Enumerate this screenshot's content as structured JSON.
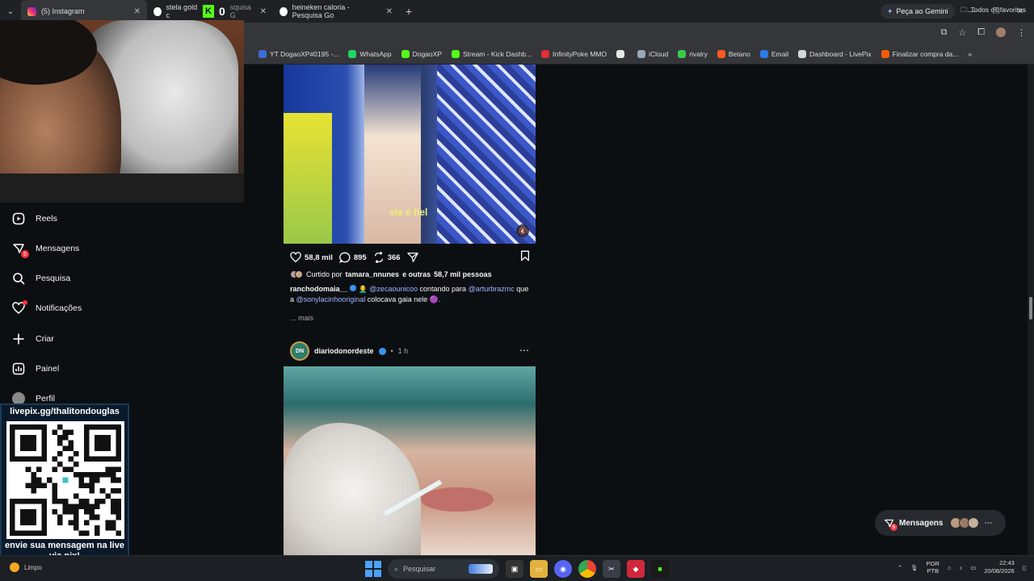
{
  "browser": {
    "tabs": [
      {
        "label": "(5) Instagram",
        "active": true,
        "icon": "instagram-icon"
      },
      {
        "label": "stela gold c",
        "active": false,
        "icon": "google-icon"
      },
      {
        "label": "heineken caloria - Pesquisa Go",
        "active": false,
        "icon": "google-icon"
      }
    ],
    "tab_partial": "squisa G",
    "gemini_label": "Peça ao Gemini",
    "overlay_counter": "0",
    "bookmarks": [
      {
        "label": "YT DogaoXP#0195 -...",
        "color": "#3c6ed6"
      },
      {
        "label": "WhatsApp",
        "color": "#25d366"
      },
      {
        "label": "DogaoXP",
        "color": "#53fc18"
      },
      {
        "label": "Stream - Kick Dashb...",
        "color": "#53fc18"
      },
      {
        "label": "InfinityPoke MMO",
        "color": "#e0303a"
      },
      {
        "label": "",
        "color": "#e7e7e7"
      },
      {
        "label": "iCloud",
        "color": "#9aa7b8"
      },
      {
        "label": "rivalry",
        "color": "#3cc94a"
      },
      {
        "label": "Betano",
        "color": "#ff5a1f"
      },
      {
        "label": "Email",
        "color": "#2c7be5"
      },
      {
        "label": "Dashboard - LivePix",
        "color": "#cfd8dc"
      },
      {
        "label": "Finalizar compra da...",
        "color": "#f25c05"
      }
    ],
    "bookmarks_overflow": "»",
    "bookmarks_all": "Todos os favoritos"
  },
  "sidebar": {
    "items": [
      {
        "label": "Reels",
        "icon": "reels-icon"
      },
      {
        "label": "Mensagens",
        "icon": "messenger-icon",
        "badge": "5"
      },
      {
        "label": "Pesquisa",
        "icon": "search-icon"
      },
      {
        "label": "Notificações",
        "icon": "heart-icon"
      },
      {
        "label": "Criar",
        "icon": "plus-icon"
      },
      {
        "label": "Painel",
        "icon": "dashboard-icon"
      },
      {
        "label": "Perfil",
        "icon": "avatar"
      }
    ]
  },
  "qr_overlay": {
    "url": "livepix.gg/thalitondouglas",
    "message": "envie sua mensagem na live via pix!"
  },
  "post1": {
    "video_caption": "ela é fiel",
    "likes": "58,8 mil",
    "comments": "895",
    "reposts": "366",
    "liked_prefix": "Curtido por",
    "liked_user": "tamara_nnunes",
    "liked_suffix": "e outras",
    "liked_count": "58,7 mil pessoas",
    "author": "ranchodomaia__",
    "caption_emoji": "👨‍🦲",
    "mention1": "@zecaounicoo",
    "caption_mid": "contando para",
    "mention2": "@arturbrazmc",
    "caption_que": "que",
    "caption_a": "a",
    "mention3": "@sonylacinhooriginal",
    "caption_end": "colocava gaia nele",
    "caption_end_emoji": "🟣.",
    "more": "... mais"
  },
  "post2": {
    "avatar_text": "DN",
    "author": "diariodonordeste",
    "time": "1 h"
  },
  "floating_messages": {
    "label": "Mensagens",
    "badge": "5"
  },
  "taskbar": {
    "weather": "Limpo",
    "search_placeholder": "Pesquisar",
    "lang_top": "POR",
    "lang_bottom": "PTB",
    "time": "22:43",
    "date": "20/08/2026"
  }
}
